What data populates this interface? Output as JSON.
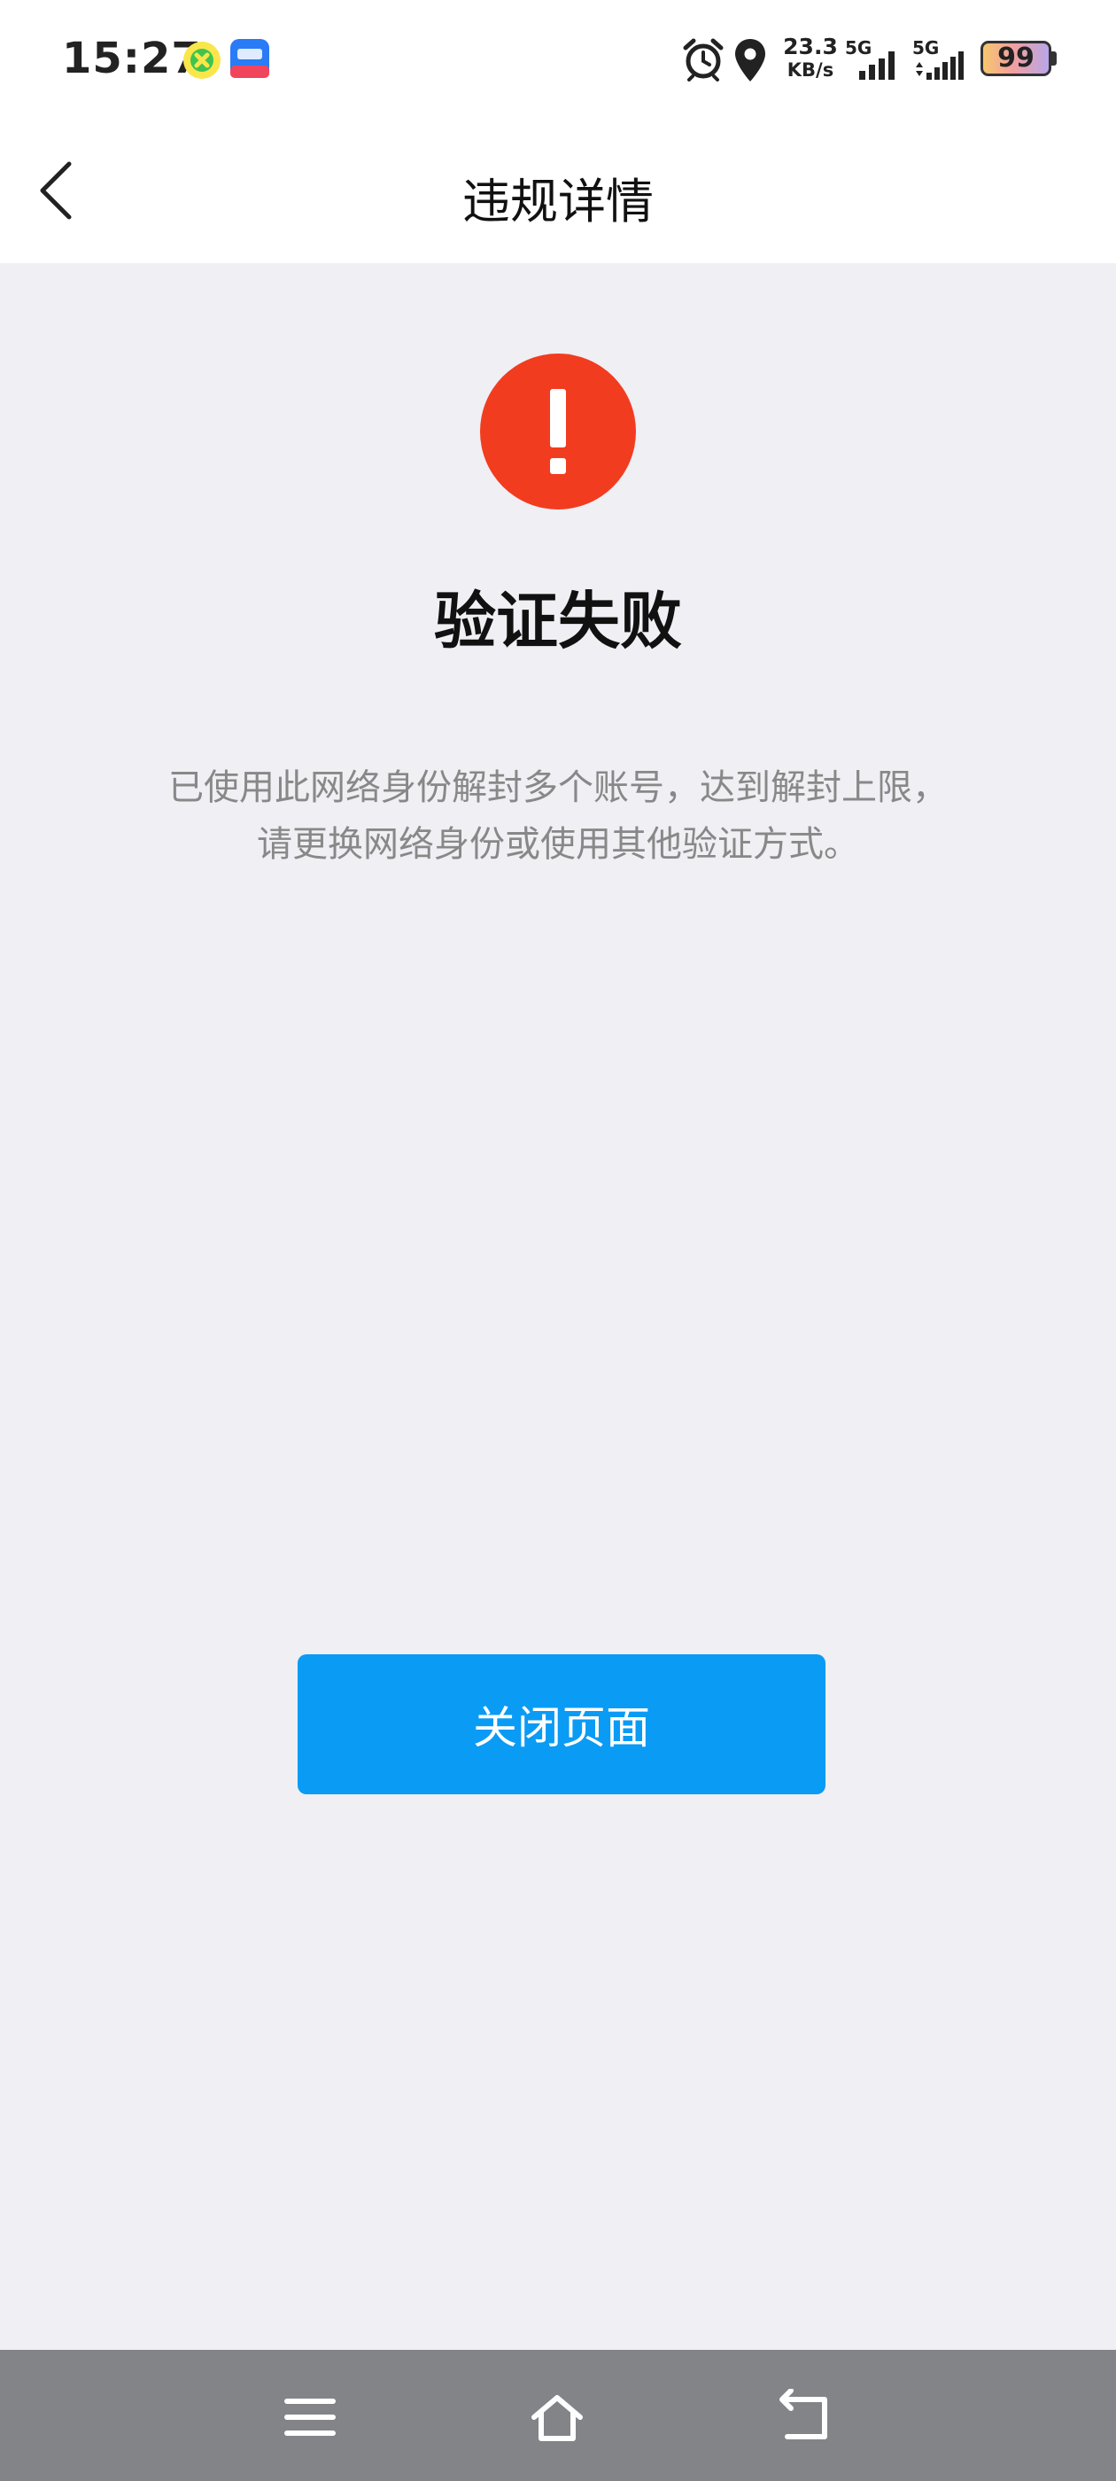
{
  "status_bar": {
    "time": "15:27",
    "net_speed_value": "23.3",
    "net_speed_unit": "KB/s",
    "signal_1_label": "5G",
    "signal_2_label": "5G",
    "battery_level": "99",
    "icons": [
      "qq-music-app-icon",
      "haluo-app-icon",
      "alarm-icon",
      "location-icon",
      "signal-icon",
      "battery-icon"
    ]
  },
  "nav": {
    "title": "违规详情",
    "back_icon": "chevron-left-icon"
  },
  "result": {
    "icon": "exclamation-circle-icon",
    "title": "验证失败",
    "message": "已使用此网络身份解封多个账号，达到解封上限，请更换网络身份或使用其他验证方式。"
  },
  "actions": {
    "close_label": "关闭页面"
  },
  "colors": {
    "accent": "#0a9bf5",
    "error": "#f23c1f",
    "background": "#efeff4",
    "system_nav": "#828488"
  },
  "system_nav": {
    "icons": [
      "menu-icon",
      "home-icon",
      "back-icon"
    ]
  }
}
